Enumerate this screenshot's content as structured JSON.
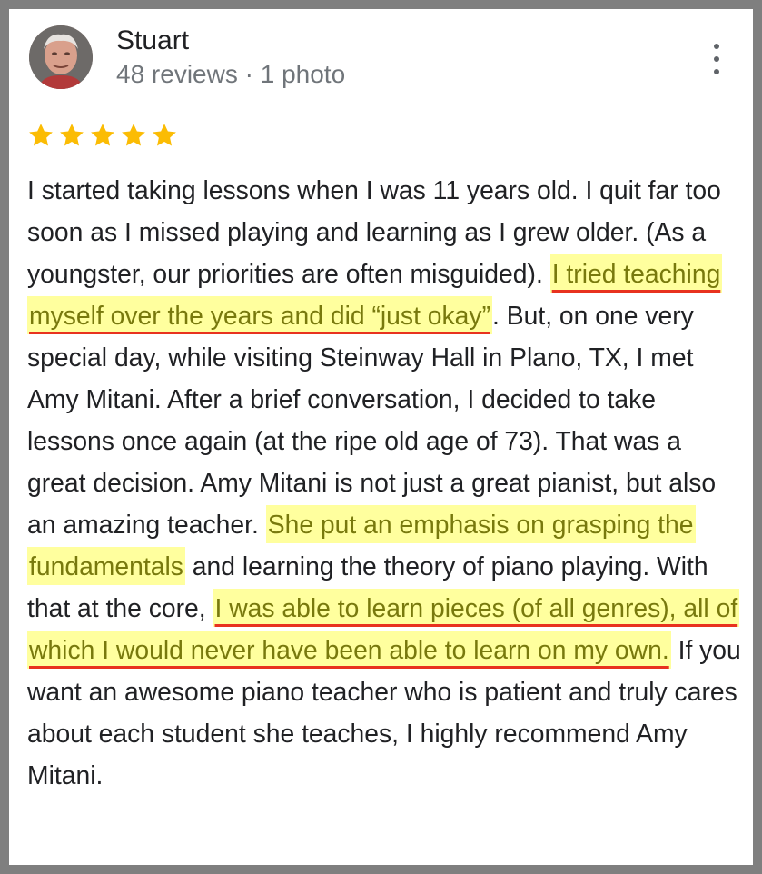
{
  "reviewer": {
    "name": "Stuart",
    "meta": "48 reviews · 1 photo"
  },
  "rating": {
    "stars": 5,
    "max": 5,
    "color": "#fbbc04"
  },
  "menu_icon": "more-vert-icon",
  "review": {
    "p1": "I started taking lessons when I was 11 years old. I quit far too soon as I missed playing and learning as I grew older. (As a youngster, our priorities are often misguided).",
    "h1": "I tried teaching myself over the years and did “just okay”",
    "p2": ". But, on one very special day, while visiting Steinway Hall in Plano, TX, I met Amy Mitani. After a brief conversation, I decided to take lessons once again (at the ripe old age of 73).  That was a great decision. Amy Mitani is not just a great pianist, but also an amazing teacher.",
    "h2": "She put an emphasis on grasping the fundamentals",
    "p3": "and learning the theory of piano playing. With that at the core,",
    "h3": "I was able to learn pieces (of all genres), all of which I would never have been able to learn on my own.",
    "p4": "If you want an awesome piano teacher who is patient and truly cares about each student she teaches, I highly recommend Amy Mitani."
  },
  "colors": {
    "highlight_bg": "#ffff9e",
    "highlight_text": "#78790d",
    "underline": "#e8321f"
  }
}
